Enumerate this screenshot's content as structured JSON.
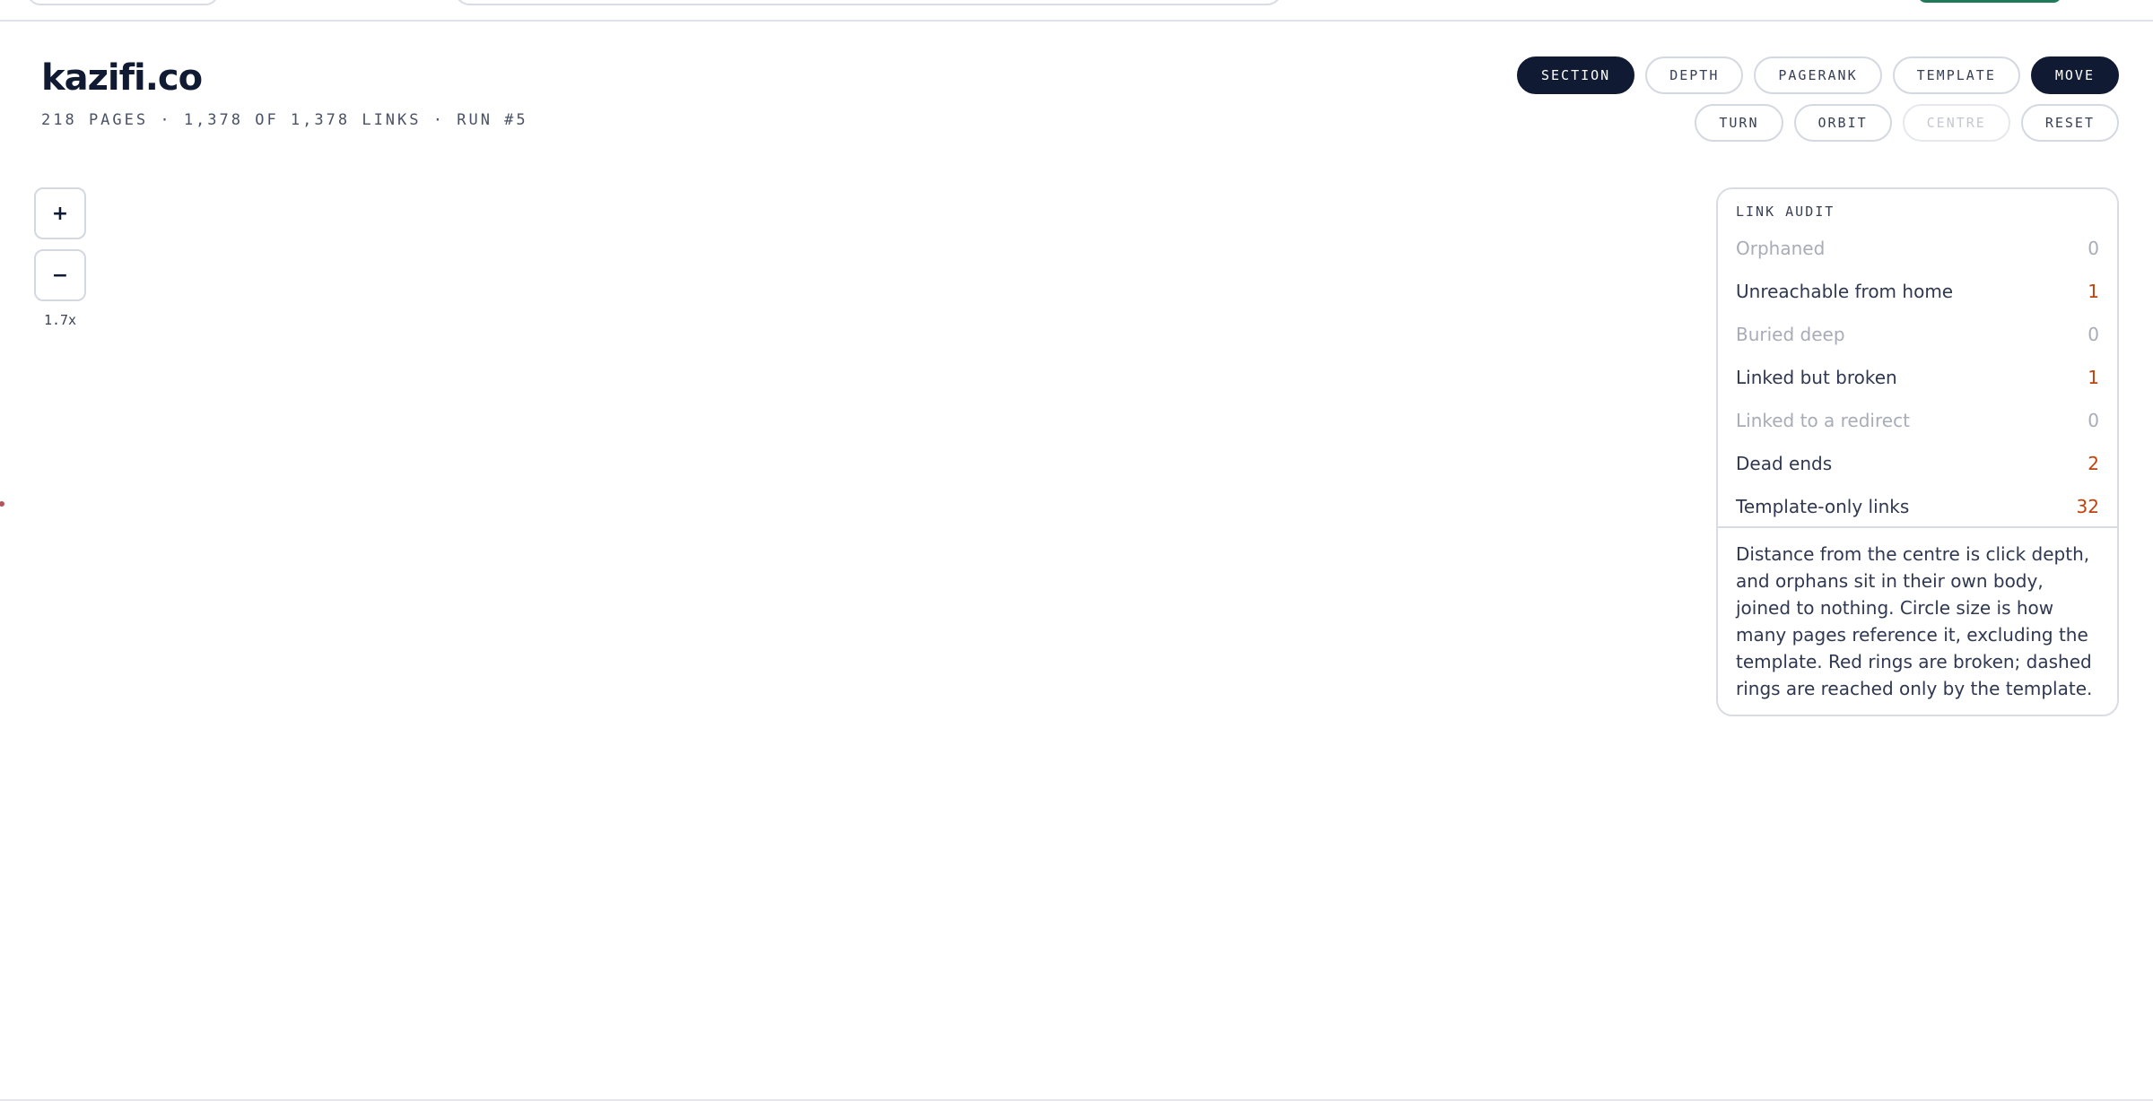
{
  "header": {
    "site": "kazifi.co",
    "meta": "218 PAGES · 1,378 OF 1,378 LINKS · RUN #5"
  },
  "controls": {
    "row1": [
      {
        "label": "SECTION",
        "state": "active"
      },
      {
        "label": "DEPTH",
        "state": "normal"
      },
      {
        "label": "PAGERANK",
        "state": "normal"
      },
      {
        "label": "TEMPLATE",
        "state": "normal"
      },
      {
        "label": "MOVE",
        "state": "active"
      }
    ],
    "row2": [
      {
        "label": "TURN",
        "state": "normal"
      },
      {
        "label": "ORBIT",
        "state": "normal"
      },
      {
        "label": "CENTRE",
        "state": "disabled"
      },
      {
        "label": "RESET",
        "state": "normal"
      }
    ]
  },
  "zoom": {
    "in_label": "+",
    "out_label": "−",
    "level": "1.7x"
  },
  "audit": {
    "title": "LINK AUDIT",
    "rows": [
      {
        "label": "Orphaned",
        "count": "0"
      },
      {
        "label": "Unreachable from home",
        "count": "1"
      },
      {
        "label": "Buried deep",
        "count": "0"
      },
      {
        "label": "Linked but broken",
        "count": "1"
      },
      {
        "label": "Linked to a redirect",
        "count": "0"
      },
      {
        "label": "Dead ends",
        "count": "2"
      },
      {
        "label": "Template-only links",
        "count": "32"
      }
    ],
    "note": "Distance from the centre is click depth, and orphans sit in their own body, joined to nothing. Circle size is how many pages reference it, excluding the template. Red rings are broken; dashed rings are reached only by the template."
  },
  "colors": {
    "ink": "#111a33",
    "alert": "#c2410c",
    "muted": "#a7acb8",
    "border": "#d4d8e1",
    "node_broken": "#b4535b",
    "accent_green": "#1f7a58"
  }
}
